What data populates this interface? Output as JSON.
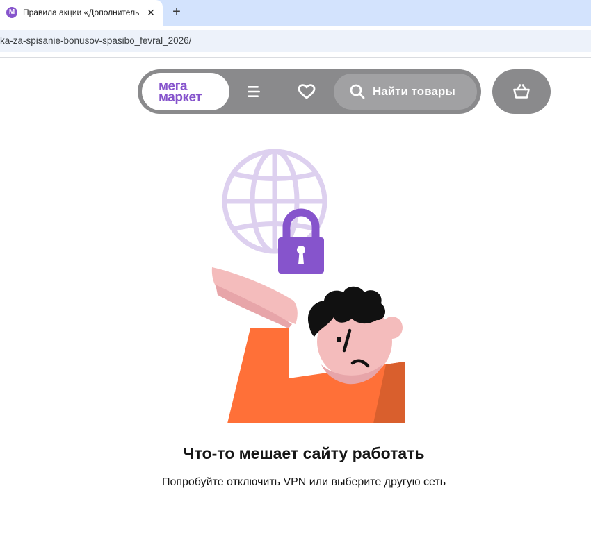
{
  "browser": {
    "tab": {
      "favicon_letter": "M",
      "title": "Правила акции «Дополнитель",
      "close_symbol": "✕"
    },
    "new_tab_symbol": "+",
    "url": "ka-za-spisanie-bonusov-spasibo_fevral_2026/"
  },
  "header": {
    "logo_line1": "мега",
    "logo_line2": "маркет",
    "menu_icon": "hamburger-menu-icon",
    "favorites_icon": "heart-icon",
    "search_icon": "search-icon",
    "search_label": "Найти товары",
    "cart_icon": "basket-icon"
  },
  "error": {
    "title": "Что-то мешает сайту работать",
    "subtitle": "Попробуйте отключить VPN или выберите другую сеть"
  },
  "colors": {
    "brand": "#8654cc",
    "header_bg": "#8a8a8c",
    "globe": "#ddd0ef",
    "lock": "#8654cc",
    "shirt": "#ff7038",
    "skin": "#f4bcbc",
    "hair": "#111111"
  }
}
